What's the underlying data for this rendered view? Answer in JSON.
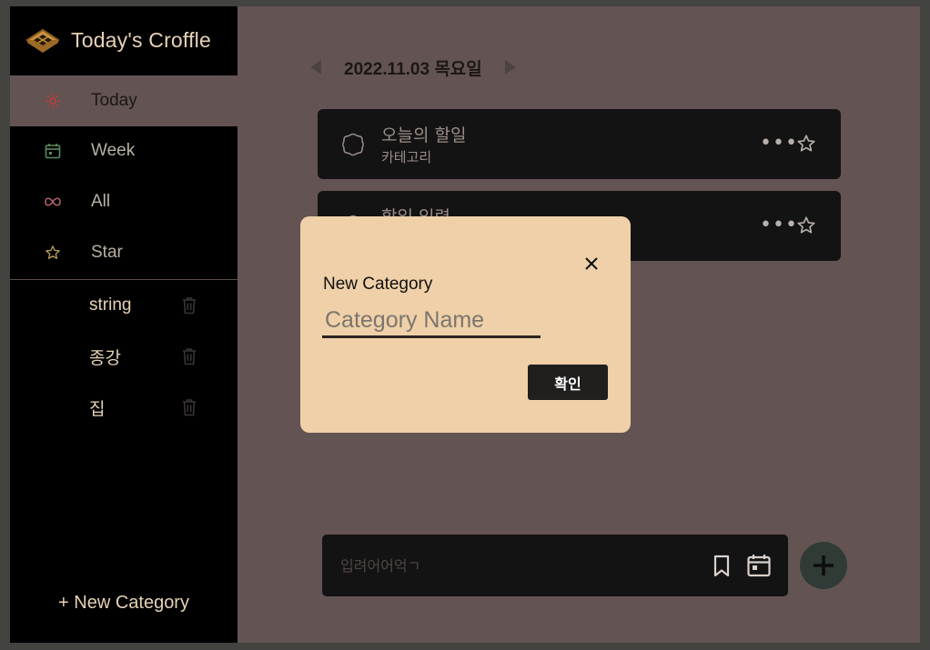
{
  "brand": {
    "title": "Today's Croffle",
    "logo_icon": "croffle-logo-icon"
  },
  "nav": [
    {
      "label": "Today",
      "icon": "sun-icon",
      "color": "#e6d2b6",
      "icon_color": "#c33a3a",
      "active": true
    },
    {
      "label": "Week",
      "icon": "calendar-icon",
      "color": "#b7b1a3",
      "icon_color": "#5a8a5e",
      "active": false
    },
    {
      "label": "All",
      "icon": "infinity-icon",
      "color": "#b7b1a3",
      "icon_color": "#b35f6a",
      "active": false
    },
    {
      "label": "Star",
      "icon": "star-icon",
      "color": "#b7b1a3",
      "icon_color": "#b89a5a",
      "active": false
    }
  ],
  "categories": [
    {
      "label": "string"
    },
    {
      "label": "종강"
    },
    {
      "label": "집"
    }
  ],
  "new_category_label": "+ New Category",
  "date": {
    "text": "2022.11.03 목요일"
  },
  "todos": [
    {
      "title": "오늘의 할일",
      "category": "카테고리"
    },
    {
      "title": "할일 입력",
      "category": ""
    }
  ],
  "input_bar": {
    "placeholder": "입려어어억ㄱ"
  },
  "modal": {
    "label": "New Category",
    "input_placeholder": "Category Name",
    "confirm_label": "확인"
  },
  "colors": {
    "sidebar_bg": "#000000",
    "main_bg": "#635453",
    "card_bg": "#141313",
    "modal_bg": "#efd0a8",
    "add_button_bg": "#2f3b34"
  }
}
